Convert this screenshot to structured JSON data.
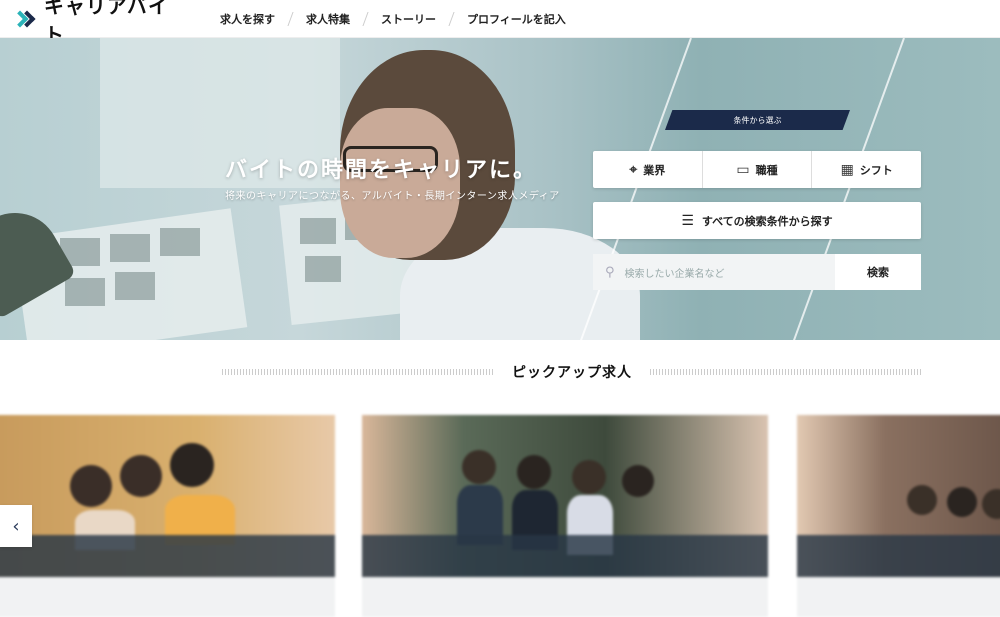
{
  "header": {
    "logo_text": "キャリアバイト",
    "nav": [
      "求人を探す",
      "求人特集",
      "ストーリー",
      "プロフィールを記入"
    ]
  },
  "hero": {
    "title": "バイトの時間をキャリアに。",
    "subtitle": "将来のキャリアにつながる、アルバイト・長期インターン求人メディア",
    "condition_tag": "条件から選ぶ",
    "segments": [
      {
        "icon": "target-icon",
        "label": "業界"
      },
      {
        "icon": "briefcase-icon",
        "label": "職種"
      },
      {
        "icon": "calendar-icon",
        "label": "シフト"
      }
    ],
    "all_conditions_label": "すべての検索条件から探す",
    "search": {
      "placeholder": "検索したい企業名など",
      "button": "検索"
    }
  },
  "pickup": {
    "title": "ピックアップ求人"
  },
  "colors": {
    "navy": "#1b2a4a",
    "teal": "#2bb3b8"
  }
}
